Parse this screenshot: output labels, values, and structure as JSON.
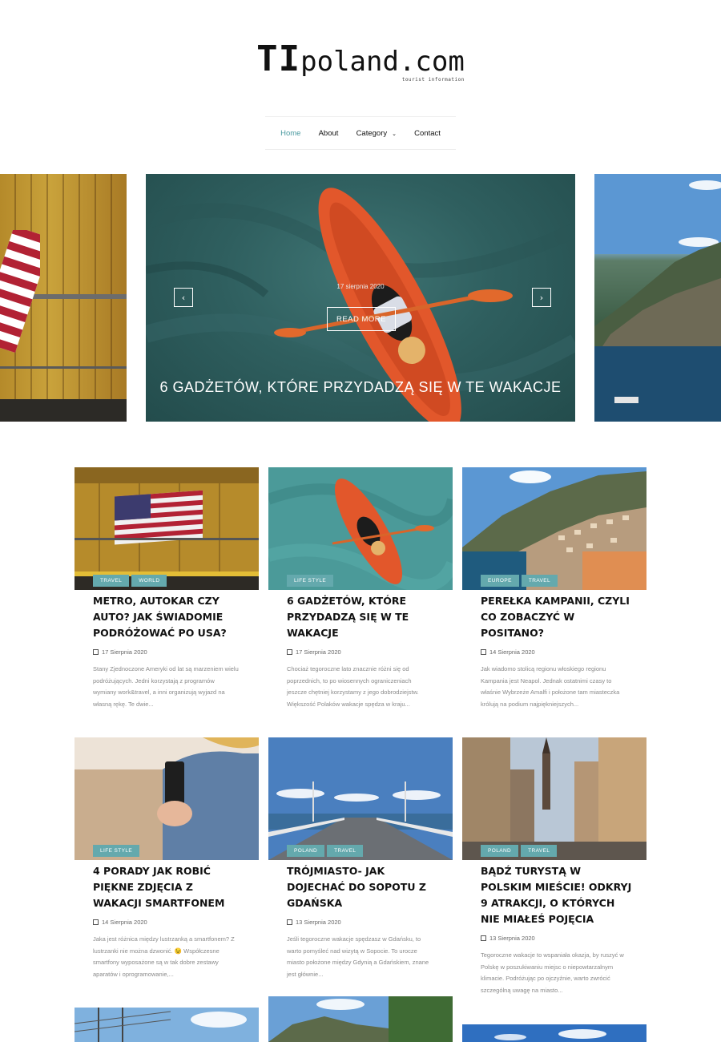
{
  "logo": {
    "ti": "TI",
    "rest": "poland.com",
    "tagline": "tourist information"
  },
  "nav": {
    "items": [
      "Home",
      "About",
      "Category",
      "Contact"
    ]
  },
  "slider": {
    "date": "17 sierpnia 2020",
    "read_more": "READ MORE",
    "title": "6 GADŻETÓW, KTÓRE PRZYDADZĄ SIĘ W TE WAKACJE",
    "prev": "‹",
    "next": "›"
  },
  "posts": [
    {
      "tags": [
        "TRAVEL",
        "WORLD"
      ],
      "title": "METRO, AUTOKAR CZY AUTO? JAK ŚWIADOMIE PODRÓŻOWAĆ PO USA?",
      "date": "17 Sierpnia 2020",
      "excerpt": "Stany Zjednoczone Ameryki od lat są marzeniem wielu podróżujących. Jedni korzystają z programów wymiany work&travel, a inni organizują wyjazd na własną rękę. Te dwie..."
    },
    {
      "tags": [
        "LIFE STYLE"
      ],
      "title": "6 GADŻETÓW, KTÓRE PRZYDADZĄ SIĘ W TE WAKACJE",
      "date": "17 Sierpnia 2020",
      "excerpt": "Chociaż tegoroczne lato znacznie różni się od poprzednich, to po wiosennych ograniczeniach jeszcze chętniej korzystamy z jego dobrodziejstw. Większość Polaków wakacje spędza w kraju..."
    },
    {
      "tags": [
        "EUROPE",
        "TRAVEL"
      ],
      "title": "PEREŁKA KAMPANII, CZYLI CO ZOBACZYĆ W POSITANO?",
      "date": "14 Sierpnia 2020",
      "excerpt": "Jak wiadomo stolicą regionu włoskiego regionu Kampania jest Neapol. Jednak ostatnimi czasy to właśnie Wybrzeże Amalfi i położone tam miasteczka królują na podium najpiękniejszych..."
    },
    {
      "tags": [
        "LIFE STYLE"
      ],
      "title": "4 PORADY JAK ROBIĆ PIĘKNE ZDJĘCIA Z WAKACJI SMARTFONEM",
      "date": "14 Sierpnia 2020",
      "excerpt": "Jaka jest różnica między lustrzanką a smartfonem? Z lustrzanki nie można dzwonić. 😉 Współczesne smartfony wyposażone są w tak dobre zestawy aparatów i oprogramowanie,..."
    },
    {
      "tags": [
        "POLAND",
        "TRAVEL"
      ],
      "title": "TRÓJMIASTO- JAK DOJECHAĆ DO SOPOTU Z GDAŃSKA",
      "date": "13 Sierpnia 2020",
      "excerpt": "Jeśli tegoroczne wakacje spędzasz w Gdańsku, to warto pomyśleć nad wizytą w Sopocie. To urocze miasto położone między Gdynią a Gdańskiem, znane jest głównie..."
    },
    {
      "tags": [
        "POLAND",
        "TRAVEL"
      ],
      "title": "BĄDŹ TURYSTĄ W POLSKIM MIEŚCIE! ODKRYJ 9 ATRAKCJI, O KTÓRYCH NIE MIAŁEŚ POJĘCIA",
      "date": "13 Sierpnia 2020",
      "excerpt": "Tegoroczne wakacje to wspaniała okazja, by ruszyć w Polskę w poszukiwaniu miejsc o niepowtarzalnym klimacie. Podróżując po ojczyźnie, warto zwrócić szczególną uwagę na miasto..."
    }
  ]
}
